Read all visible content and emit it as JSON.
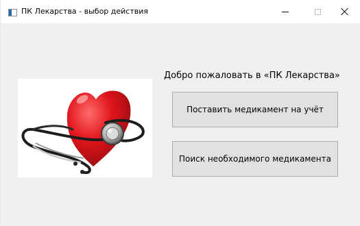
{
  "window": {
    "title": "ПК Лекарства - выбор действия",
    "icon": "app-window-icon",
    "controls": {
      "minimize": "minimize-icon",
      "maximize": "maximize-icon",
      "close": "close-icon"
    }
  },
  "main": {
    "welcome_text": "Добро пожаловать в «ПК Лекарства»",
    "image": "heart-stethoscope-image",
    "buttons": {
      "register_label": "Поставить медикамент на учёт",
      "search_label": "Поиск необходимого медикамента"
    }
  },
  "colors": {
    "window_bg": "#f0f0f0",
    "button_bg": "#e1e1e1",
    "button_border": "#adadad",
    "heart_red": "#e0141c"
  }
}
